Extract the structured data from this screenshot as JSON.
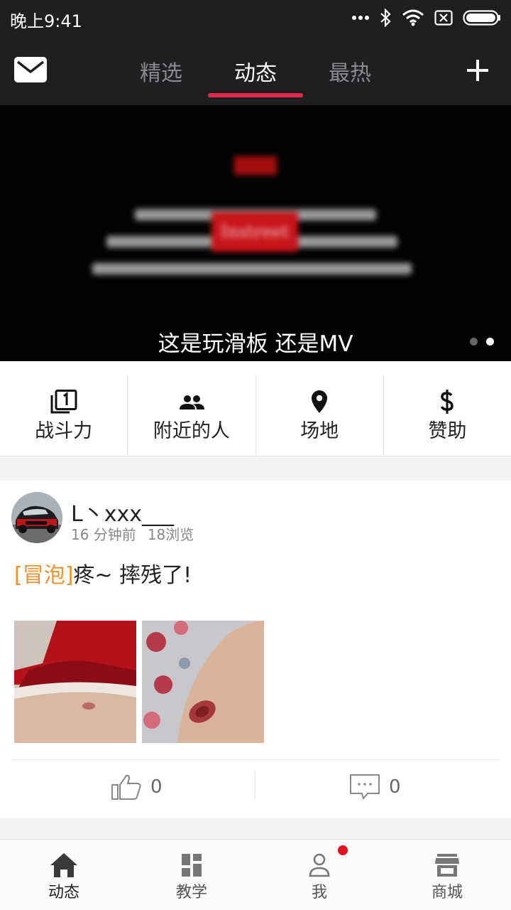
{
  "status_bar": {
    "time": "晚上9:41"
  },
  "top_nav": {
    "tabs": [
      "精选",
      "动态",
      "最热"
    ],
    "active_tab": "动态"
  },
  "banner": {
    "caption": "这是玩滑板 还是MV",
    "logo_text": "Instreet",
    "slide_count": 2,
    "active_slide": 2
  },
  "quick_menu": [
    {
      "label": "战斗力",
      "icon": "filter-1-icon"
    },
    {
      "label": "附近的人",
      "icon": "people-icon"
    },
    {
      "label": "场地",
      "icon": "location-pin-icon"
    },
    {
      "label": "赞助",
      "icon": "dollar-icon"
    }
  ],
  "post": {
    "username": "L丶xxx___",
    "time_ago": "16 分钟前",
    "views": "18浏览",
    "tag": "[冒泡]",
    "text": "疼~  摔残了!",
    "likes": "0",
    "comments": "0"
  },
  "bottom_nav": [
    {
      "label": "动态",
      "icon": "home-icon"
    },
    {
      "label": "教学",
      "icon": "grid-icon"
    },
    {
      "label": "我",
      "icon": "user-icon"
    },
    {
      "label": "商城",
      "icon": "store-icon"
    }
  ],
  "colors": {
    "accent": "#e8284b",
    "tag": "#f0912e",
    "header_bg": "#1f1f21",
    "badge": "#e0141e"
  }
}
